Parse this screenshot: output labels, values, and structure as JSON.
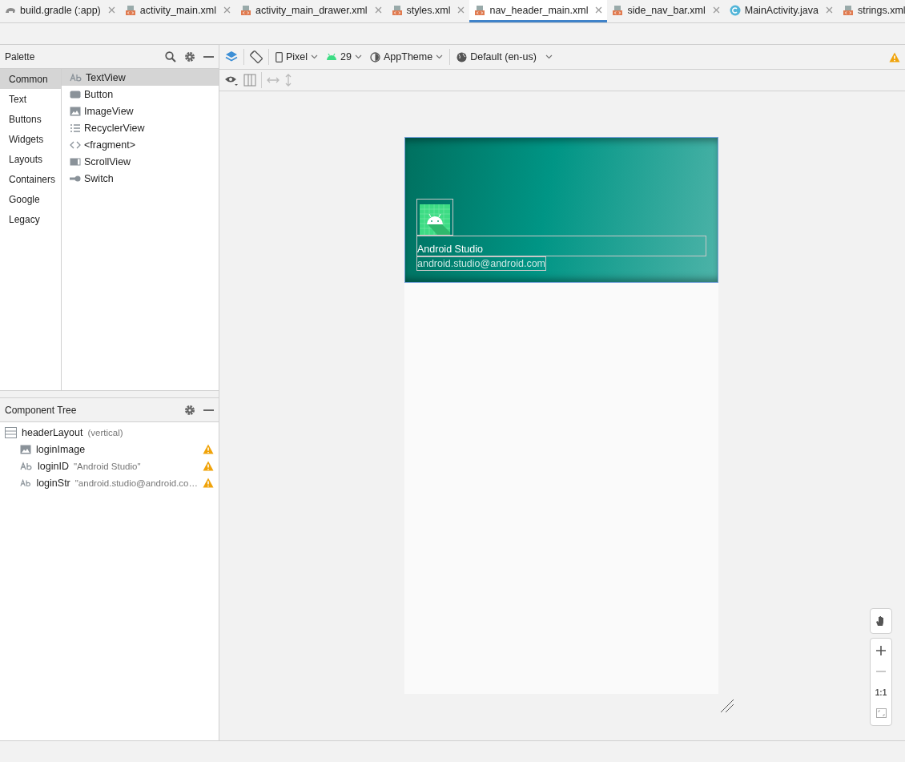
{
  "tabs": [
    {
      "label": "build.gradle (:app)",
      "kind": "gradle",
      "selected": false
    },
    {
      "label": "activity_main.xml",
      "kind": "xml",
      "selected": false
    },
    {
      "label": "activity_main_drawer.xml",
      "kind": "xml",
      "selected": false
    },
    {
      "label": "styles.xml",
      "kind": "xml",
      "selected": false
    },
    {
      "label": "nav_header_main.xml",
      "kind": "xml",
      "selected": true
    },
    {
      "label": "side_nav_bar.xml",
      "kind": "xml",
      "selected": false
    },
    {
      "label": "MainActivity.java",
      "kind": "java",
      "selected": false
    },
    {
      "label": "strings.xml",
      "kind": "xml",
      "selected": false
    }
  ],
  "palette": {
    "title": "Palette",
    "categories": [
      {
        "label": "Common",
        "selected": true
      },
      {
        "label": "Text",
        "selected": false
      },
      {
        "label": "Buttons",
        "selected": false
      },
      {
        "label": "Widgets",
        "selected": false
      },
      {
        "label": "Layouts",
        "selected": false
      },
      {
        "label": "Containers",
        "selected": false
      },
      {
        "label": "Google",
        "selected": false
      },
      {
        "label": "Legacy",
        "selected": false
      }
    ],
    "items": [
      {
        "label": "TextView",
        "kind": "text",
        "selected": true
      },
      {
        "label": "Button",
        "kind": "button",
        "selected": false
      },
      {
        "label": "ImageView",
        "kind": "image",
        "selected": false
      },
      {
        "label": "RecyclerView",
        "kind": "list",
        "selected": false
      },
      {
        "label": "<fragment>",
        "kind": "code",
        "selected": false
      },
      {
        "label": "ScrollView",
        "kind": "scroll",
        "selected": false
      },
      {
        "label": "Switch",
        "kind": "switch",
        "selected": false
      }
    ]
  },
  "component_tree": {
    "title": "Component Tree",
    "root": {
      "name": "headerLayout",
      "detail": "(vertical)",
      "children": [
        {
          "name": "loginImage",
          "kind": "image",
          "warning": true
        },
        {
          "name": "loginID",
          "detail": "\"Android Studio\"",
          "kind": "text",
          "warning": true
        },
        {
          "name": "loginStr",
          "detail": "\"android.studio@android.co…",
          "kind": "text",
          "warning": true
        }
      ]
    }
  },
  "toolbar": {
    "device": "Pixel",
    "api": "29",
    "theme": "AppTheme",
    "locale": "Default (en-us)",
    "warning": true
  },
  "preview": {
    "name": "Android Studio",
    "email": "android.studio@android.com"
  },
  "zoom_controls": {
    "actual_size": "1:1"
  }
}
